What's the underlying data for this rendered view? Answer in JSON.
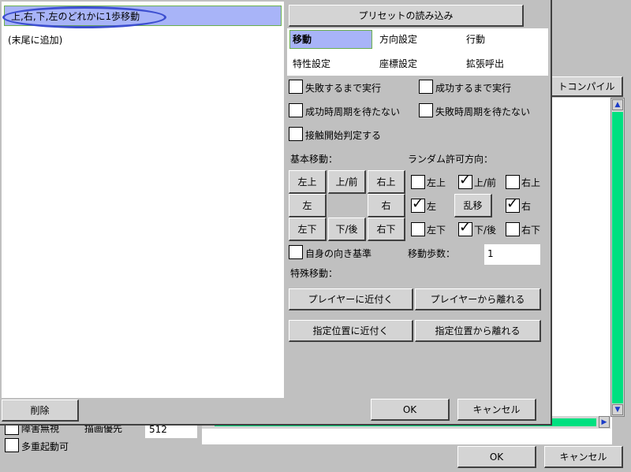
{
  "list": {
    "items": [
      "上,右,下,左のどれかに1歩移動",
      "(末尾に追加)"
    ],
    "delete_label": "削除"
  },
  "bg": {
    "compile_label": "トコンパイル",
    "checks": [
      "障害無視",
      "多重起動可"
    ],
    "draw_priority_label": "描画優先",
    "draw_priority_value": "512",
    "ok_label": "OK",
    "cancel_label": "キャンセル"
  },
  "dialog": {
    "preset_label": "プリセットの読み込み",
    "tabs": [
      "移動",
      "方向設定",
      "行動",
      "特性設定",
      "座標設定",
      "拡張呼出"
    ],
    "options": [
      "失敗するまで実行",
      "成功するまで実行",
      "成功時周期を待たない",
      "失敗時周期を待たない",
      "接触開始判定する"
    ],
    "basic_move_label": "基本移動：",
    "random_dir_label": "ランダム許可方向：",
    "basic_buttons": [
      "左上",
      "上/前",
      "右上",
      "左",
      "右",
      "左下",
      "下/後",
      "右下"
    ],
    "random_dirs": [
      "左上",
      "上/前",
      "右上",
      "左",
      "右",
      "左下",
      "下/後",
      "右下"
    ],
    "random_move_label": "乱移",
    "self_dir_label": "自身の向き基準",
    "move_steps_label": "移動歩数：",
    "move_steps_value": "1",
    "special_move_label": "特殊移動：",
    "special_buttons": [
      "プレイヤーに近付く",
      "プレイヤーから離れる",
      "指定位置に近付く",
      "指定位置から離れる"
    ],
    "ok_label": "OK",
    "cancel_label": "キャンセル"
  },
  "colors": {
    "accent": "#3d4fd0",
    "scroll_thumb": "#00e080",
    "selected_bg": "#a8b4f8"
  }
}
